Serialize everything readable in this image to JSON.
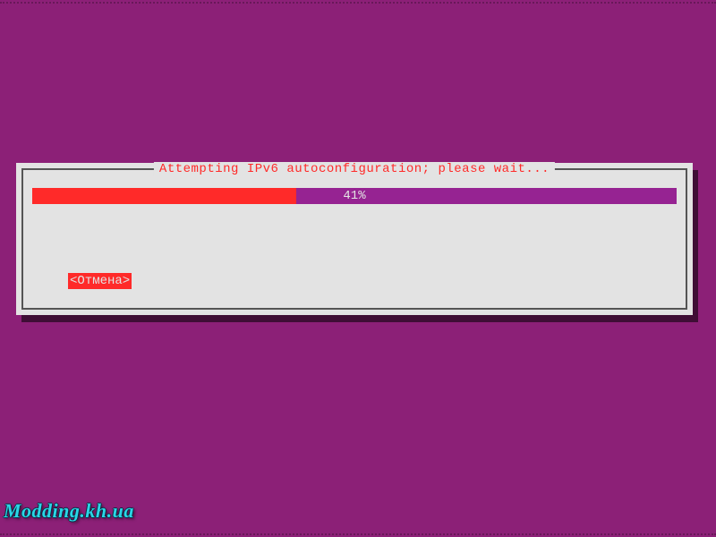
{
  "dialog": {
    "title": "Attempting IPv6 autoconfiguration; please wait...",
    "progress_percent": 41,
    "progress_label": "41%",
    "cancel_label": "<Отмена>"
  },
  "watermark": "Modding.kh.ua",
  "colors": {
    "background": "#8c2077",
    "panel": "#e3e3e3",
    "accent_red": "#ff2a29",
    "accent_purple": "#962392"
  }
}
